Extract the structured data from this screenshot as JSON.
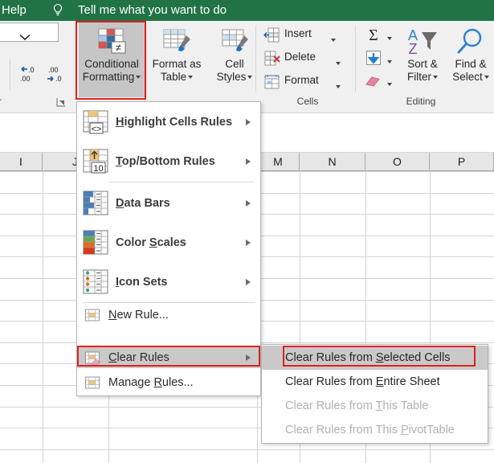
{
  "titlebar": {
    "help_label": "Help",
    "bulb_icon": "lightbulb-icon",
    "tellme_text": "Tell me what you want to do",
    "bg_color": "#217346"
  },
  "ribbon": {
    "number_group": {
      "label": "r",
      "format_dropdown_value": "",
      "decrease_decimal_icon": "decrease-decimal-icon",
      "increase_decimal_icon": "increase-decimal-icon",
      "launcher_icon": "dialog-launcher-icon"
    },
    "styles_group": {
      "buttons": [
        {
          "line1": "Conditional",
          "line2": "Formatting",
          "icon": "conditional-formatting-icon",
          "has_caret": true,
          "highlighted": true
        },
        {
          "line1": "Format as",
          "line2": "Table",
          "icon": "format-as-table-icon",
          "has_caret": true,
          "highlighted": false
        },
        {
          "line1": "Cell",
          "line2": "Styles",
          "icon": "cell-styles-icon",
          "has_caret": true,
          "highlighted": false
        }
      ]
    },
    "cells_group": {
      "label": "Cells",
      "items": [
        {
          "label": "Insert",
          "icon": "insert-cells-icon",
          "has_caret": true
        },
        {
          "label": "Delete",
          "icon": "delete-cells-icon",
          "has_caret": true
        },
        {
          "label": "Format",
          "icon": "format-cells-icon",
          "has_caret": true
        }
      ]
    },
    "editing_group": {
      "label": "Editing",
      "autosum_icon": "autosum-sigma-icon",
      "fill_icon": "fill-down-icon",
      "clear_icon": "clear-eraser-icon",
      "sort_filter": {
        "line1": "Sort &",
        "line2": "Filter",
        "icon": "sort-filter-icon",
        "has_caret": true
      },
      "find_select": {
        "line1": "Find &",
        "line2": "Select",
        "icon": "find-select-magnifier-icon",
        "has_caret": true
      }
    }
  },
  "worksheet": {
    "column_headers": [
      "I",
      "J",
      "",
      "M",
      "N",
      "O",
      "P"
    ]
  },
  "conditional_formatting_menu": {
    "items": [
      {
        "label": "Highlight Cells Rules",
        "accel": "H",
        "icon": "highlight-cells-rules-icon",
        "has_submenu": true,
        "selected": false
      },
      {
        "label": "Top/Bottom Rules",
        "accel": "T",
        "icon": "top-bottom-rules-icon",
        "has_submenu": true,
        "selected": false
      },
      {
        "label": "Data Bars",
        "accel": "D",
        "icon": "data-bars-icon",
        "has_submenu": true,
        "selected": false
      },
      {
        "label": "Color Scales",
        "accel": "S",
        "icon": "color-scales-icon",
        "has_submenu": true,
        "selected": false
      },
      {
        "label": "Icon Sets",
        "accel": "I",
        "icon": "icon-sets-icon",
        "has_submenu": true,
        "selected": false
      }
    ],
    "commands": [
      {
        "label": "New Rule...",
        "accel": "N",
        "icon": "new-rule-icon",
        "has_submenu": false,
        "selected": false
      },
      {
        "label": "Clear Rules",
        "accel": "C",
        "icon": "clear-rules-icon",
        "has_submenu": true,
        "selected": true
      },
      {
        "label": "Manage Rules...",
        "accel": "R",
        "icon": "manage-rules-icon",
        "has_submenu": false,
        "selected": false
      }
    ]
  },
  "clear_rules_submenu": {
    "items": [
      {
        "label": "Clear Rules from Selected Cells",
        "accel": "S",
        "disabled": false,
        "selected": true
      },
      {
        "label": "Clear Rules from Entire Sheet",
        "accel": "E",
        "disabled": false,
        "selected": false
      },
      {
        "label": "Clear Rules from This Table",
        "accel": "T",
        "disabled": true,
        "selected": false
      },
      {
        "label": "Clear Rules from This PivotTable",
        "accel": "P",
        "disabled": true,
        "selected": false
      }
    ]
  },
  "highlight_color": "#e02020"
}
